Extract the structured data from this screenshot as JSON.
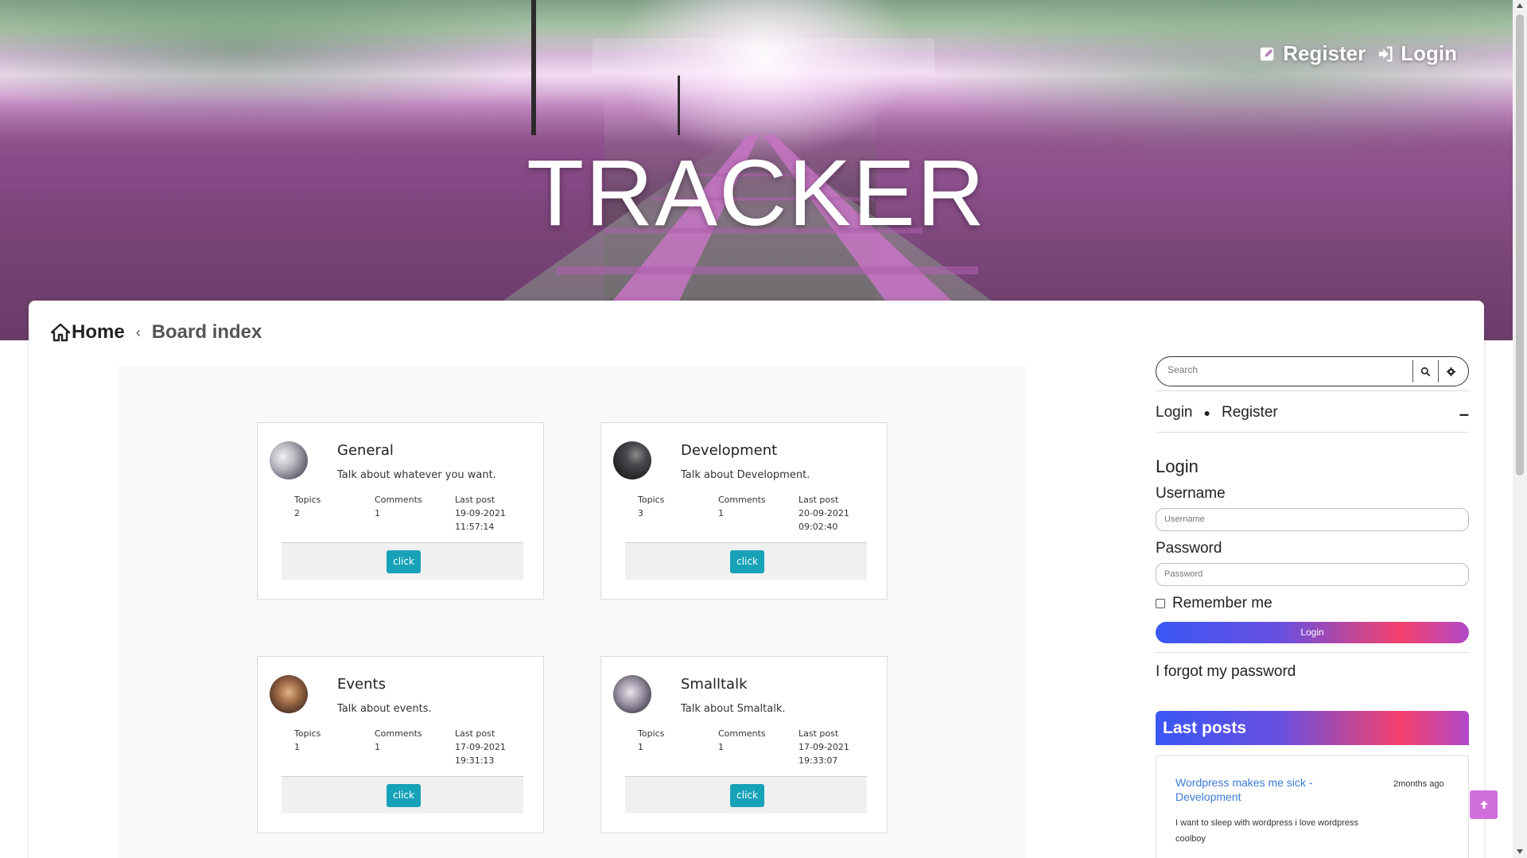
{
  "hero": {
    "title": "TRACKER",
    "tagline": "",
    "nav": {
      "register_label": "Register",
      "login_label": "Login"
    }
  },
  "breadcrumb": {
    "home_label": "Home",
    "separator": "‹",
    "current_label": "Board index"
  },
  "forums": [
    {
      "title": "General",
      "description": "Talk about whatever you want.",
      "topics_label": "Topics",
      "topics": "2",
      "comments_label": "Comments",
      "comments": "1",
      "last_post_label": "Last post",
      "last_post_date": "19-09-2021",
      "last_post_time": "11:57:14",
      "button_label": "click"
    },
    {
      "title": "Development",
      "description": "Talk about Development.",
      "topics_label": "Topics",
      "topics": "3",
      "comments_label": "Comments",
      "comments": "1",
      "last_post_label": "Last post",
      "last_post_date": "20-09-2021",
      "last_post_time": "09:02:40",
      "button_label": "click"
    },
    {
      "title": "Events",
      "description": "Talk about events.",
      "topics_label": "Topics",
      "topics": "1",
      "comments_label": "Comments",
      "comments": "1",
      "last_post_label": "Last post",
      "last_post_date": "17-09-2021",
      "last_post_time": "19:31:13",
      "button_label": "click"
    },
    {
      "title": "Smalltalk",
      "description": "Talk about Smaltalk.",
      "topics_label": "Topics",
      "topics": "1",
      "comments_label": "Comments",
      "comments": "1",
      "last_post_label": "Last post",
      "last_post_date": "17-09-2021",
      "last_post_time": "19:33:07",
      "button_label": "click"
    }
  ],
  "sidebar": {
    "search_placeholder": "Search",
    "login_link": "Login",
    "register_link": "Register",
    "collapse_symbol": "–",
    "login_title": "Login",
    "username_label": "Username",
    "username_placeholder": "Username",
    "password_label": "Password",
    "password_placeholder": "Password",
    "remember_label": "Remember me",
    "login_button": "Login",
    "forgot_label": "I forgot my password",
    "last_posts_title": "Last posts",
    "last_post": {
      "title": "Wordpress makes me sick - Development",
      "time": "2months ago",
      "body": "I want to sleep with wordpress i love wordpress coolboy"
    }
  },
  "colors": {
    "accent_teal": "#17a2b8",
    "gradient_start": "#3a57f5",
    "gradient_mid": "#f4416c",
    "gradient_end": "#b148c9",
    "link_blue": "#3a7bd5",
    "scroll_top_pink": "#d06edb"
  }
}
